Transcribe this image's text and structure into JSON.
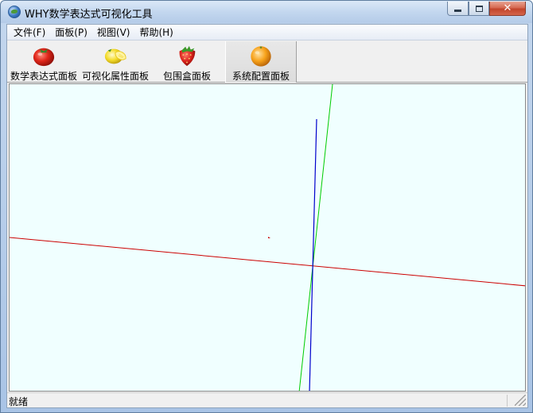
{
  "window": {
    "title": "WHY数学表达式可视化工具",
    "close_glyph": "✕"
  },
  "menu": [
    {
      "label": "文件(F)"
    },
    {
      "label": "面板(P)"
    },
    {
      "label": "视图(V)"
    },
    {
      "label": "帮助(H)"
    }
  ],
  "toolbar": {
    "buttons": [
      {
        "label": "数学表达式面板",
        "icon": "tomato-icon"
      },
      {
        "label": "可视化属性面板",
        "icon": "lemon-icon"
      },
      {
        "label": "包围盒面板",
        "icon": "strawberry-icon"
      },
      {
        "label": "系统配置面板",
        "icon": "orange-icon"
      }
    ]
  },
  "canvas": {
    "background": "#f0ffff",
    "axis_colors": {
      "x": "#cc0000",
      "y": "#0000cc",
      "z": "#00cc00"
    }
  },
  "status": {
    "text": "就绪"
  }
}
